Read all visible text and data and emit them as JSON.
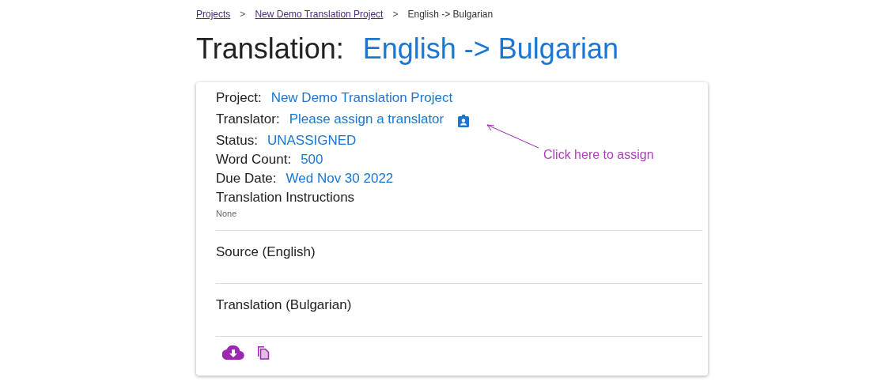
{
  "breadcrumb": [
    {
      "label": "Projects",
      "kind": "link"
    },
    {
      "label": "New Demo Translation Project",
      "kind": "link"
    },
    {
      "label": "English -> Bulgarian",
      "kind": "current"
    }
  ],
  "separator": ">",
  "title": {
    "label": "Translation:",
    "value": "English -> Bulgarian"
  },
  "details": [
    {
      "label": "Project:",
      "value": "New Demo Translation Project"
    },
    {
      "label": "Translator:",
      "value": "Please assign a translator",
      "kind": "assign"
    },
    {
      "label": "Status:",
      "value": "UNASSIGNED"
    },
    {
      "label": "Word Count:",
      "value": "500"
    },
    {
      "label": "Due Date:",
      "value": "Wed Nov 30 2022"
    }
  ],
  "instructions": {
    "label": "Translation Instructions",
    "value": "None"
  },
  "sections": [
    "Source (English)",
    "Translation (Bulgarian)"
  ],
  "annotation": "Click here to assign"
}
